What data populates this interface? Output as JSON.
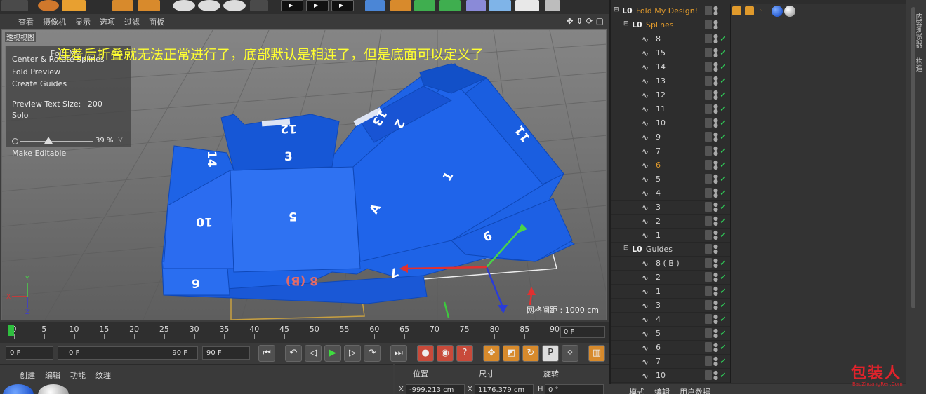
{
  "viewport_menu": [
    "查看",
    "摄像机",
    "显示",
    "选项",
    "过滤",
    "面板"
  ],
  "viewport": {
    "label": "透视视图",
    "grid_info": "网格间距 : 1000 cm",
    "caption": "连着后折叠就无法正常进行了，底部默认是相连了，但是底面可以定义了"
  },
  "fold_panel": {
    "header": "Fold My",
    "items": [
      "Center & Rotate Splines",
      "Fold Preview",
      "Create Guides"
    ],
    "preview_text_size_label": "Preview Text Size:",
    "preview_text_size_value": "200",
    "solo_label": "Solo",
    "slider_value": "39 %",
    "make_editable": "Make Editable"
  },
  "model_labels": [
    "12",
    "3",
    "14",
    "10",
    "5",
    "A",
    "1",
    "11",
    "6",
    "7",
    "9",
    "8 (B)",
    "2",
    "13"
  ],
  "timeline": {
    "ticks": [
      "0",
      "5",
      "10",
      "15",
      "20",
      "25",
      "30",
      "35",
      "40",
      "45",
      "50",
      "55",
      "60",
      "65",
      "70",
      "75",
      "80",
      "85",
      "90"
    ],
    "current_frame": "0 F"
  },
  "transport": {
    "start_frame": "0 F",
    "range_start": "0 F",
    "range_end": "90 F",
    "end_frame": "90 F"
  },
  "material_menu": [
    "创建",
    "编辑",
    "功能",
    "纹理"
  ],
  "coords": {
    "headers": [
      "位置",
      "尺寸",
      "旋转"
    ],
    "x_pos": "-999.213 cm",
    "x_size": "1176.379 cm",
    "h_rot": "0 °",
    "x_label": "X",
    "h_label": "H"
  },
  "object_manager": {
    "root": "Fold My Design!",
    "splines_group": "Splines",
    "splines": [
      "8",
      "15",
      "14",
      "13",
      "12",
      "11",
      "10",
      "9",
      "7",
      "6",
      "5",
      "4",
      "3",
      "2",
      "1"
    ],
    "highlighted_spline": "6",
    "guides_group": "Guides",
    "guides": [
      "8 ( B )",
      "2",
      "1",
      "3",
      "4",
      "5",
      "6",
      "7",
      "10"
    ]
  },
  "object_bottom_menu": [
    "模式",
    "编辑",
    "用户数据"
  ],
  "side_tabs": [
    "内容浏览器",
    "构造"
  ],
  "watermark": "包装人",
  "watermark_sub": "BaoZhuangRen.Com",
  "colors": {
    "model_blue": "#1e63e6",
    "highlight_orange": "#e09a2c",
    "check_green": "#2fd35a",
    "caption_yellow": "#ffff30"
  }
}
